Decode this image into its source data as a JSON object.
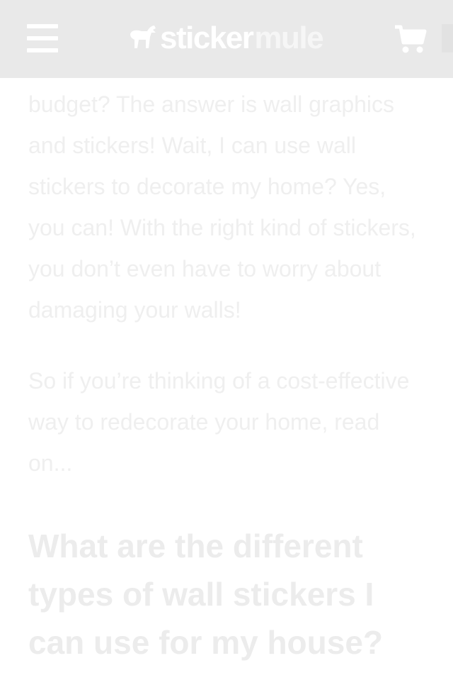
{
  "header": {
    "logo_part1": "sticker",
    "logo_part2": "mule",
    "menu_icon": "hamburger-menu-icon",
    "cart_icon": "shopping-cart-icon"
  },
  "article": {
    "paragraph_1": "budget? The answer is wall graphics and stickers! Wait, I can use wall stickers to decorate my home? Yes, you can! With the right kind of stickers, you don’t even have to worry about damaging your walls!",
    "paragraph_2": "So if you’re thinking of a cost-effective way to redecorate your home, read on...",
    "heading": "What are the different types of wall stickers I can use for my house?"
  },
  "colors": {
    "header_bg": "#e9e9e9",
    "text": "#efefef",
    "heading": "#ececec"
  }
}
